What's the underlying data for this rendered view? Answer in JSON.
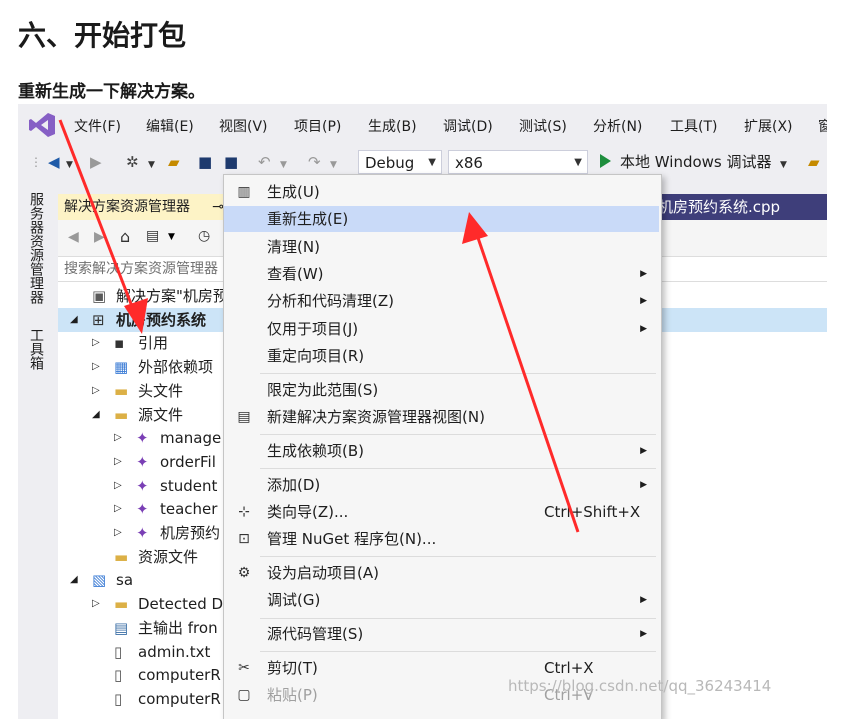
{
  "heading": "六、开始打包",
  "subheading": "重新生成一下解决方案。",
  "menubar": {
    "items": [
      "文件(F)",
      "编辑(E)",
      "视图(V)",
      "项目(P)",
      "生成(B)",
      "调试(D)",
      "测试(S)",
      "分析(N)",
      "工具(T)",
      "扩展(X)",
      "窗"
    ]
  },
  "toolbar": {
    "config": "Debug",
    "platform": "x86",
    "run_label": "本地 Windows 调试器"
  },
  "sidetabs": [
    "服务器资源管理器",
    "工具箱"
  ],
  "solution_explorer": {
    "title": "解决方案资源管理器",
    "title_pin": "⊸",
    "doc_tab": "机房预约系统.cpp",
    "search_placeholder": "搜索解决方案资源管理器",
    "tree": [
      {
        "label": "解决方案\"机房预约",
        "indent": 0,
        "twisty": "",
        "icon": "solution-icon"
      },
      {
        "label": "机房预约系统",
        "indent": 0,
        "twisty": "◢",
        "icon": "project-icon",
        "bold": true,
        "selected": true
      },
      {
        "label": "引用",
        "indent": 1,
        "twisty": "▷",
        "icon": "references-icon"
      },
      {
        "label": "外部依赖项",
        "indent": 1,
        "twisty": "▷",
        "icon": "external-deps-icon"
      },
      {
        "label": "头文件",
        "indent": 1,
        "twisty": "▷",
        "icon": "folder-icon"
      },
      {
        "label": "源文件",
        "indent": 1,
        "twisty": "◢",
        "icon": "folder-icon"
      },
      {
        "label": "manage",
        "indent": 2,
        "twisty": "▷",
        "icon": "cpp-file-icon"
      },
      {
        "label": "orderFil",
        "indent": 2,
        "twisty": "▷",
        "icon": "cpp-file-icon"
      },
      {
        "label": "student",
        "indent": 2,
        "twisty": "▷",
        "icon": "cpp-file-icon"
      },
      {
        "label": "teacher",
        "indent": 2,
        "twisty": "▷",
        "icon": "cpp-file-icon"
      },
      {
        "label": "机房预约",
        "indent": 2,
        "twisty": "▷",
        "icon": "cpp-file-icon"
      },
      {
        "label": "资源文件",
        "indent": 1,
        "twisty": "",
        "icon": "folder-icon"
      },
      {
        "label": "sa",
        "indent": 0,
        "twisty": "◢",
        "icon": "setup-project-icon"
      },
      {
        "label": "Detected D",
        "indent": 1,
        "twisty": "▷",
        "icon": "folder-icon"
      },
      {
        "label": "主输出 fron",
        "indent": 1,
        "twisty": "",
        "icon": "output-icon"
      },
      {
        "label": "admin.txt",
        "indent": 1,
        "twisty": "",
        "icon": "text-file-icon"
      },
      {
        "label": "computerR",
        "indent": 1,
        "twisty": "",
        "icon": "text-file-icon"
      },
      {
        "label": "computerR",
        "indent": 1,
        "twisty": "",
        "icon": "text-file-icon"
      }
    ]
  },
  "context_menu": {
    "items": [
      {
        "label": "生成(U)",
        "icon": "build-icon",
        "shortcut": "",
        "submenu": false
      },
      {
        "label": "重新生成(E)",
        "icon": "",
        "shortcut": "",
        "submenu": false,
        "highlighted": true
      },
      {
        "label": "清理(N)",
        "icon": "",
        "shortcut": "",
        "submenu": false
      },
      {
        "label": "查看(W)",
        "icon": "",
        "shortcut": "",
        "submenu": true
      },
      {
        "label": "分析和代码清理(Z)",
        "icon": "",
        "shortcut": "",
        "submenu": true
      },
      {
        "label": "仅用于项目(J)",
        "icon": "",
        "shortcut": "",
        "submenu": true
      },
      {
        "label": "重定向项目(R)",
        "icon": "",
        "shortcut": "",
        "submenu": false
      },
      {
        "label": "限定为此范围(S)",
        "icon": "",
        "shortcut": "",
        "submenu": false
      },
      {
        "label": "新建解决方案资源管理器视图(N)",
        "icon": "new-view-icon",
        "shortcut": "",
        "submenu": false
      },
      {
        "label": "生成依赖项(B)",
        "icon": "",
        "shortcut": "",
        "submenu": true
      },
      {
        "label": "添加(D)",
        "icon": "",
        "shortcut": "",
        "submenu": true
      },
      {
        "label": "类向导(Z)...",
        "icon": "class-wizard-icon",
        "shortcut": "Ctrl+Shift+X",
        "submenu": false
      },
      {
        "label": "管理 NuGet 程序包(N)...",
        "icon": "nuget-icon",
        "shortcut": "",
        "submenu": false
      },
      {
        "label": "设为启动项目(A)",
        "icon": "gear-icon",
        "shortcut": "",
        "submenu": false
      },
      {
        "label": "调试(G)",
        "icon": "",
        "shortcut": "",
        "submenu": true
      },
      {
        "label": "源代码管理(S)",
        "icon": "",
        "shortcut": "",
        "submenu": true
      },
      {
        "label": "剪切(T)",
        "icon": "scissors-icon",
        "shortcut": "Ctrl+X",
        "submenu": false
      },
      {
        "label": "粘贴(P)",
        "icon": "paste-icon",
        "shortcut": "Ctrl+V",
        "submenu": false,
        "disabled": true
      }
    ]
  },
  "watermark": "https://blog.csdn.net/qq_36243414",
  "colors": {
    "ide_bg": "#eeeef2",
    "highlight": "#c9daf8",
    "selected_row": "#cce4f7",
    "doc_tab": "#3e3e7a",
    "annotation_arrow": "#ff2a2a",
    "vs_purple": "#865fc5"
  }
}
